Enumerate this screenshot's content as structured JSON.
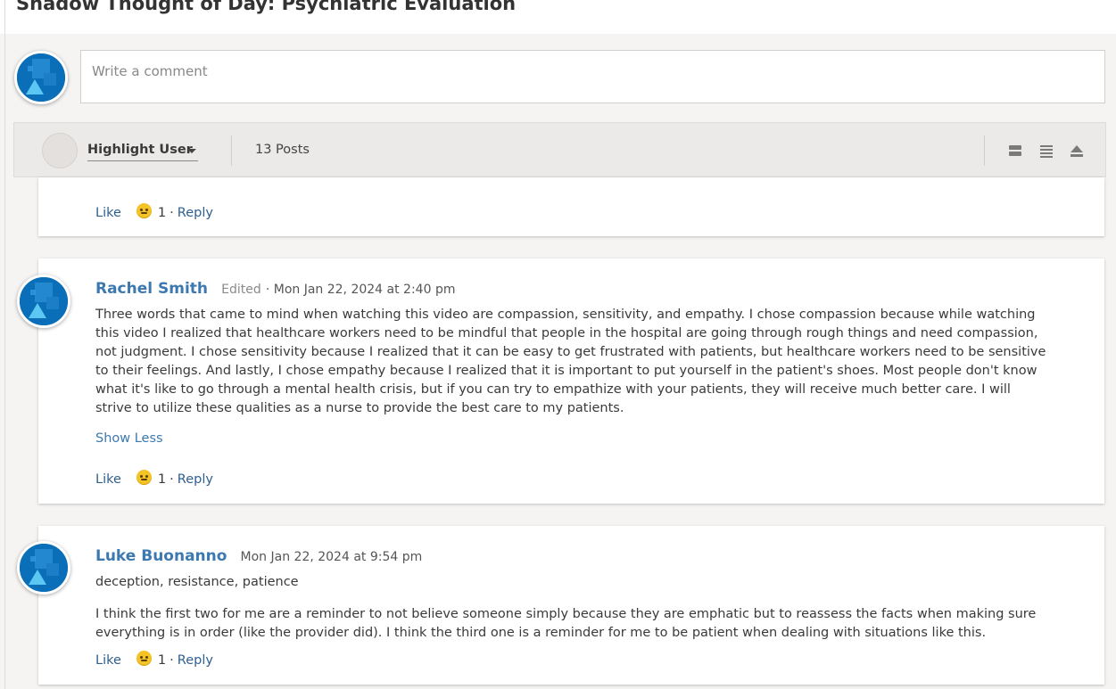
{
  "page": {
    "title": "Shadow Thought of Day: Psychiatric Evaluation"
  },
  "composer": {
    "placeholder": "Write a comment"
  },
  "toolbar": {
    "highlight_label": "Highlight User",
    "posts_count": "13 Posts",
    "view_icons": [
      "collapsed-view-icon",
      "list-view-icon",
      "collapse-all-icon"
    ]
  },
  "posts": [
    {
      "actions": {
        "like": "Like",
        "reaction_count": "1",
        "separator": "·",
        "reply": "Reply"
      }
    },
    {
      "author": "Rachel Smith",
      "edited": "Edited",
      "date": "· Mon Jan 22, 2024 at 2:40 pm",
      "body": "Three words that came to mind when watching this video are compassion, sensitivity, and empathy. I chose compassion because while watching this video I realized that healthcare workers need to be mindful that people in the hospital are going through rough things and need compassion, not judgment. I chose sensitivity because I realized that it can be easy to get frustrated with patients, but healthcare workers need to be sensitive to their feelings. And lastly, I chose empathy because I realized that it is important to put yourself in the patient's shoes. Most people don't know what it's like to go through a mental health crisis, but if you can try to empathize with your patients, they will receive much better care. I will strive to utilize these qualities as a nurse to provide the best care to my patients.",
      "show_less": "Show Less",
      "actions": {
        "like": "Like",
        "reaction_count": "1",
        "separator": "·",
        "reply": "Reply"
      }
    },
    {
      "author": "Luke Buonanno",
      "date": "Mon Jan 22, 2024 at 9:54 pm",
      "body_line1": "deception, resistance, patience",
      "body": "I think the first two for me are a reminder to not believe someone simply because they are emphatic but to reassess the facts when making sure everything is in order (like the provider did). I think the third one is a reminder for me to be patient when dealing with situations like this.",
      "actions": {
        "like": "Like",
        "reaction_count": "1",
        "separator": "·",
        "reply": "Reply"
      }
    }
  ],
  "colors": {
    "link": "#3d79b0",
    "avatar": "#0a6fb8",
    "toolbar_bg": "#ebeae8"
  }
}
